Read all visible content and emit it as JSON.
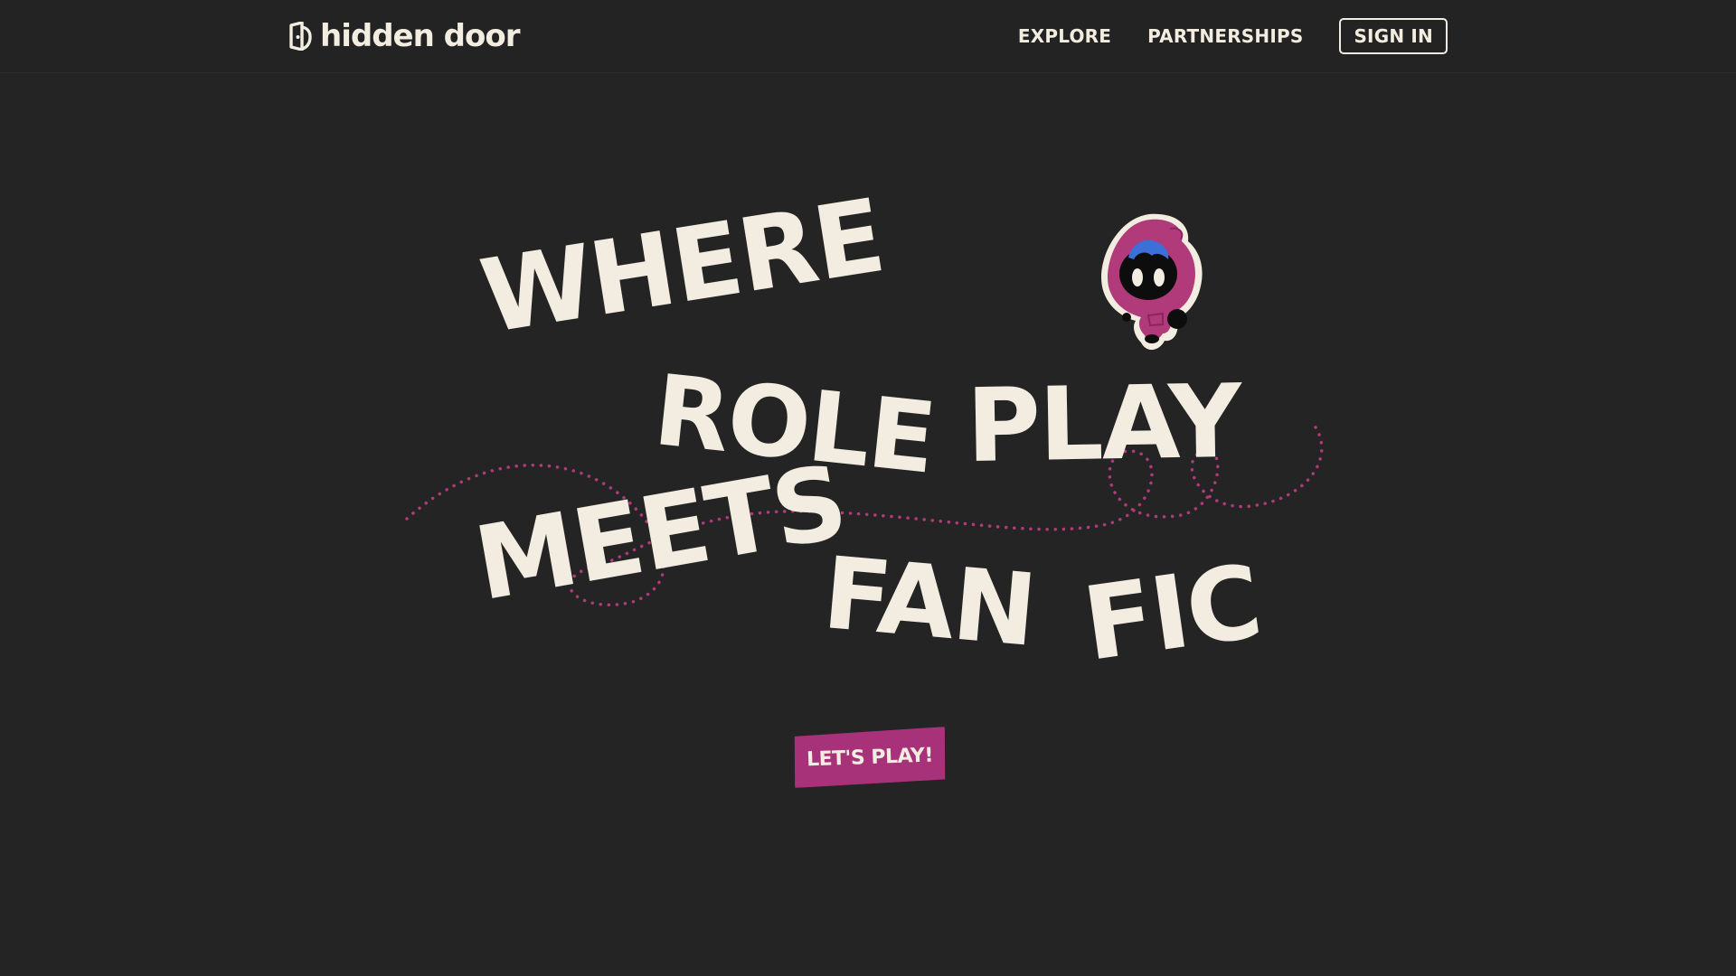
{
  "header": {
    "logo_text": "hidden door",
    "nav": {
      "explore": "EXPLORE",
      "partnerships": "PARTNERSHIPS",
      "sign_in": "SIGN IN"
    }
  },
  "hero": {
    "headline": {
      "where": "WHERE",
      "role": "ROLE",
      "play": "PLAY",
      "meets": "MEETS",
      "fan": "FAN",
      "fic": "FIC"
    },
    "cta_label": "LET'S PLAY!"
  },
  "colors": {
    "background": "#242424",
    "text": "#f2ede0",
    "accent": "#a8327a",
    "mascot_hood": "#b03a7a",
    "mascot_hair": "#3d6fd8"
  },
  "icons": {
    "logo": "door-logo-icon",
    "mascot": "hooded-mascot"
  }
}
